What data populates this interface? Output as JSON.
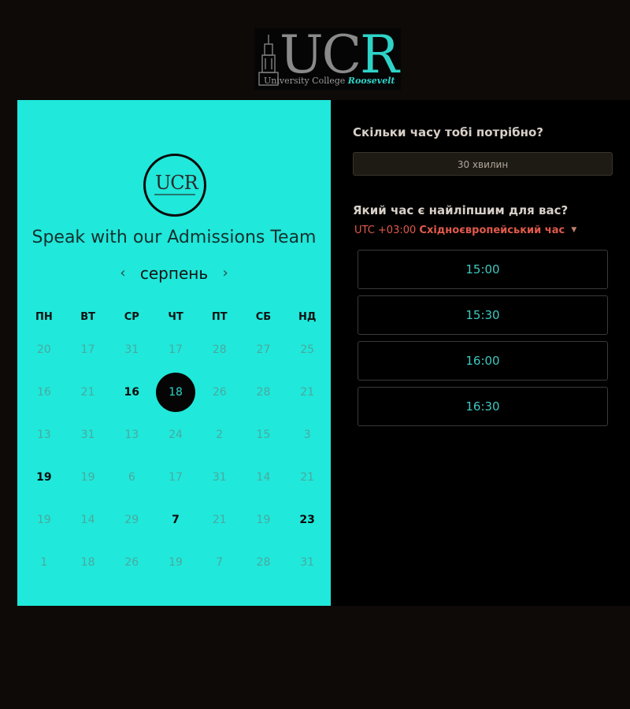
{
  "header": {
    "logo_text_u": "UC",
    "logo_text_r": "R",
    "logo_sub_a": "University College",
    "logo_sub_b": "Roosevelt"
  },
  "calendar_panel": {
    "logo_text": "UCR",
    "title": "Speak with our Admissions Team",
    "month": "серпень",
    "prev_icon": "chevron-left-icon",
    "next_icon": "chevron-right-icon",
    "weekdays": [
      "ПН",
      "ВТ",
      "СР",
      "ЧТ",
      "ПТ",
      "СБ",
      "НД"
    ],
    "weeks": [
      [
        "20",
        "17",
        "31",
        "17",
        "28",
        "27",
        "25"
      ],
      [
        "16",
        "21",
        "16",
        "18",
        "26",
        "28",
        "21"
      ],
      [
        "13",
        "31",
        "13",
        "24",
        "2",
        "15",
        "3"
      ],
      [
        "19",
        "19",
        "6",
        "17",
        "31",
        "14",
        "21"
      ],
      [
        "19",
        "14",
        "29",
        "7",
        "21",
        "19",
        "23"
      ],
      [
        "1",
        "18",
        "26",
        "19",
        "7",
        "28",
        "31"
      ]
    ],
    "selected_day": "18"
  },
  "booking_panel": {
    "duration_question": "Скільки часу тобі потрібно?",
    "duration_value": "30 хвилин",
    "time_question": "Який час є найліпшим для вас?",
    "timezone_offset": "UTC +03:00",
    "timezone_name": "Східноєвропейський час",
    "slots": [
      "15:00",
      "15:30",
      "16:00",
      "16:30"
    ]
  },
  "colors": {
    "accent": "#20e8da",
    "timezone": "#e05a4a",
    "slot_text": "#3ec8c0"
  }
}
